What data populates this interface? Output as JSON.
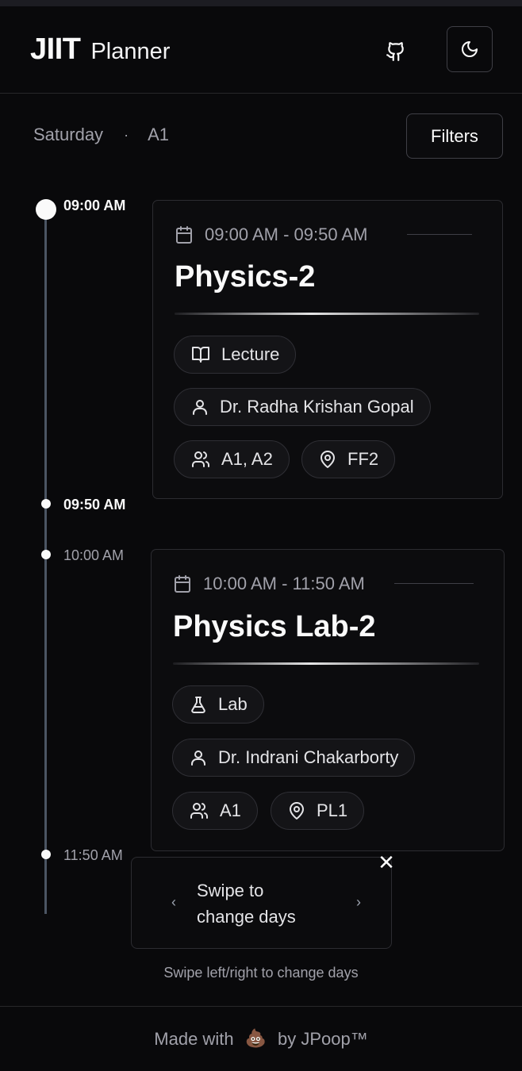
{
  "header": {
    "brand_strong": "JIIT",
    "brand_light": "Planner",
    "github_icon": "github-icon",
    "theme_icon": "moon-icon"
  },
  "day_bar": {
    "day": "Saturday",
    "separator": "·",
    "batch": "A1",
    "filters_label": "Filters"
  },
  "timeline": {
    "times": [
      "09:00 AM",
      "09:50 AM",
      "10:00 AM",
      "11:50 AM"
    ]
  },
  "classes": [
    {
      "time_range": "09:00 AM - 09:50 AM",
      "title": "Physics-2",
      "type": "Lecture",
      "type_icon": "book-open-icon",
      "teacher": "Dr. Radha Krishan Gopal",
      "batches": "A1, A2",
      "room": "FF2"
    },
    {
      "time_range": "10:00 AM - 11:50 AM",
      "title": "Physics Lab-2",
      "type": "Lab",
      "type_icon": "flask-icon",
      "teacher": "Dr. Indrani Chakarborty",
      "batches": "A1",
      "room": "PL1"
    }
  ],
  "swipe_hint": {
    "text_line1": "Swipe to",
    "text_line2": "change days",
    "left_chevron": "‹",
    "right_chevron": "›",
    "close": "✕",
    "caption": "Swipe left/right to change days"
  },
  "footer": {
    "prefix": "Made with",
    "emoji": "💩",
    "suffix": "by JPoop™"
  }
}
